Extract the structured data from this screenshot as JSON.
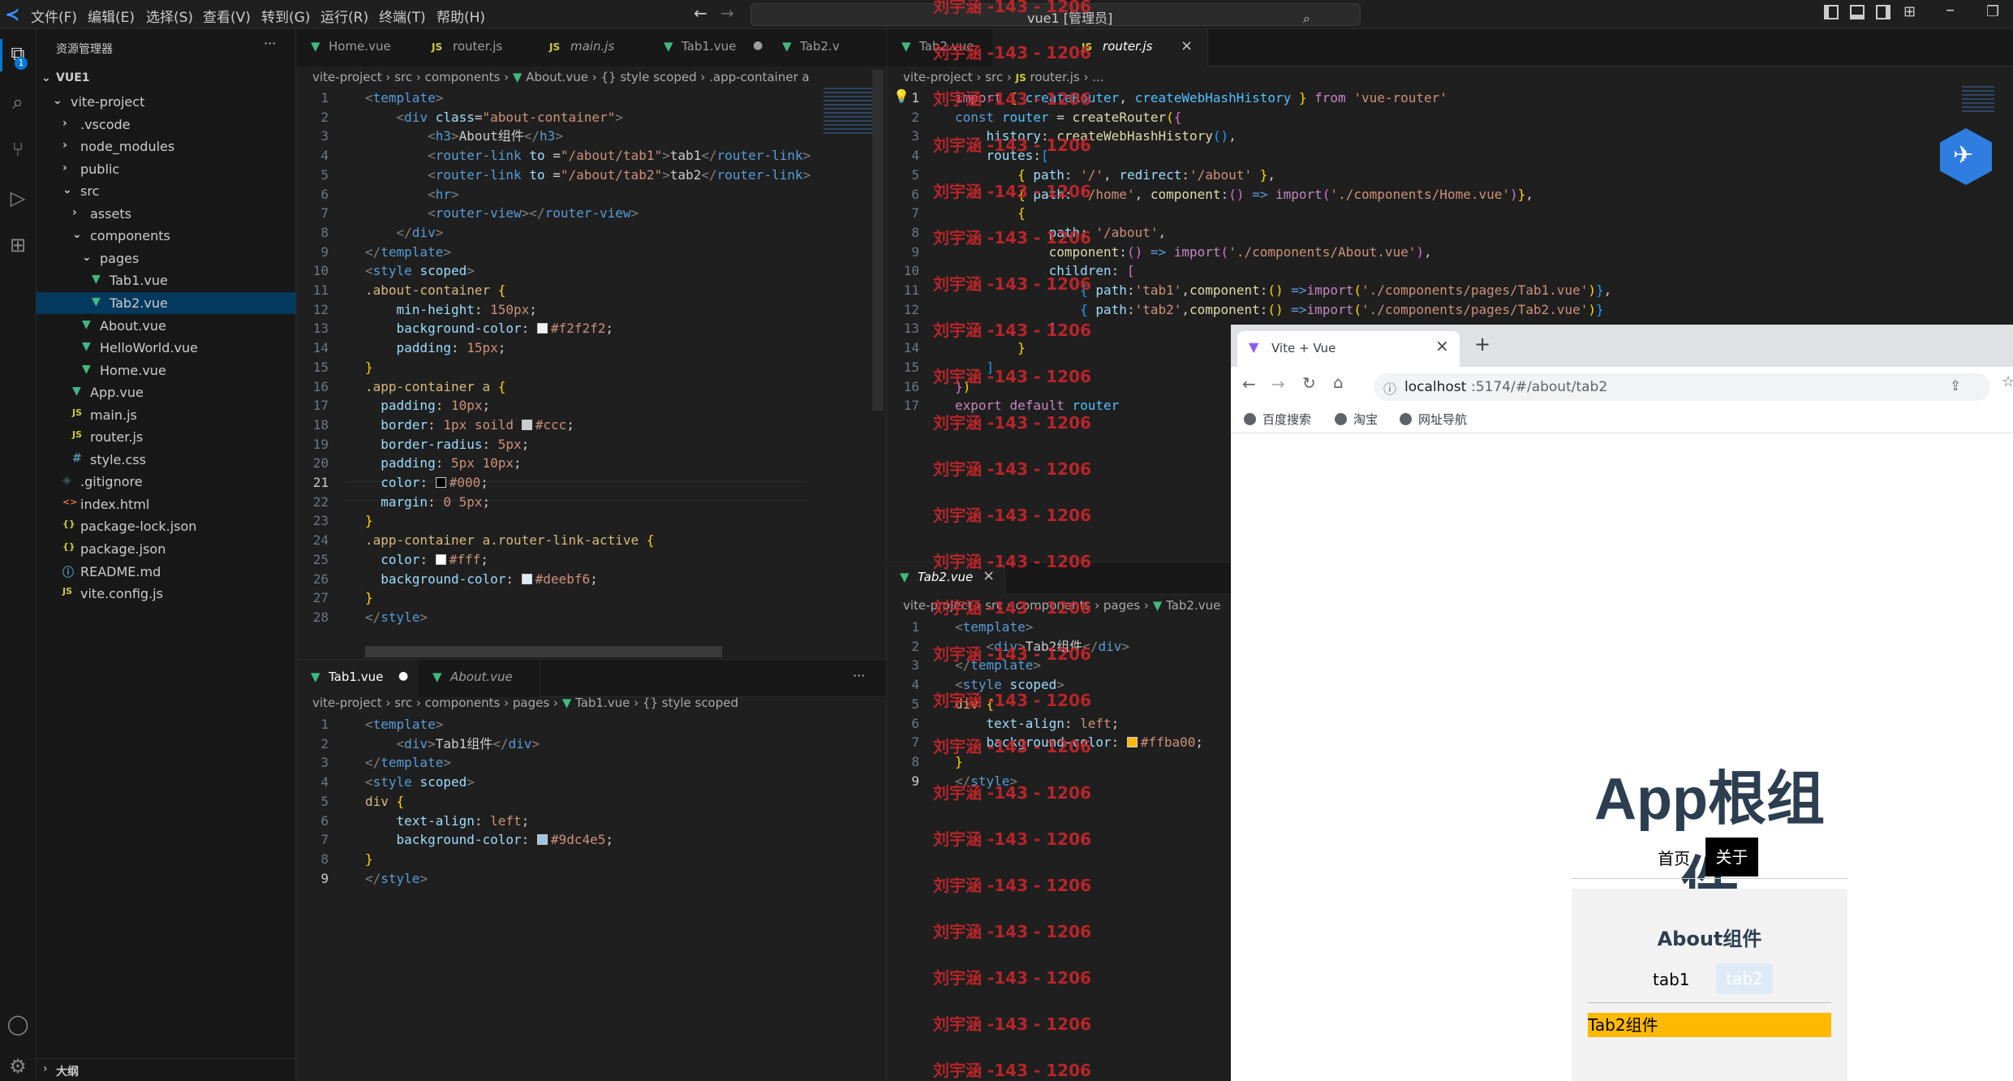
{
  "titlebar": {
    "menu": [
      "文件(F)",
      "编辑(E)",
      "选择(S)",
      "查看(V)",
      "转到(G)",
      "运行(R)",
      "终端(T)",
      "帮助(H)"
    ],
    "command_center": "vue1 [管理员]"
  },
  "sidebar": {
    "title": "资源管理器",
    "more": "···",
    "root": "VUE1",
    "items": [
      {
        "label": "vite-project",
        "icon": "chevron-down",
        "depth": 1
      },
      {
        "label": ".vscode",
        "icon": "chevron-right",
        "depth": 2
      },
      {
        "label": "node_modules",
        "icon": "chevron-right",
        "depth": 2
      },
      {
        "label": "public",
        "icon": "chevron-right",
        "depth": 2
      },
      {
        "label": "src",
        "icon": "chevron-down",
        "depth": 2
      },
      {
        "label": "assets",
        "icon": "chevron-right",
        "depth": 3
      },
      {
        "label": "components",
        "icon": "chevron-down",
        "depth": 3
      },
      {
        "label": "pages",
        "icon": "chevron-down",
        "depth": 4
      },
      {
        "label": "Tab1.vue",
        "icon": "vue",
        "depth": 5
      },
      {
        "label": "Tab2.vue",
        "icon": "vue",
        "depth": 5
      },
      {
        "label": "About.vue",
        "icon": "vue",
        "depth": 4
      },
      {
        "label": "HelloWorld.vue",
        "icon": "vue",
        "depth": 4
      },
      {
        "label": "Home.vue",
        "icon": "vue",
        "depth": 4
      },
      {
        "label": "App.vue",
        "icon": "vue",
        "depth": 3
      },
      {
        "label": "main.js",
        "icon": "js",
        "depth": 3
      },
      {
        "label": "router.js",
        "icon": "js",
        "depth": 3
      },
      {
        "label": "style.css",
        "icon": "css",
        "depth": 3
      },
      {
        "label": ".gitignore",
        "icon": "git",
        "depth": 2
      },
      {
        "label": "index.html",
        "icon": "html",
        "depth": 2
      },
      {
        "label": "package-lock.json",
        "icon": "json",
        "depth": 2
      },
      {
        "label": "package.json",
        "icon": "json",
        "depth": 2
      },
      {
        "label": "README.md",
        "icon": "info",
        "depth": 2
      },
      {
        "label": "vite.config.js",
        "icon": "js",
        "depth": 2
      }
    ],
    "outline": "大纲"
  },
  "editor_left_top": {
    "tabs": [
      "Home.vue",
      "router.js",
      "main.js",
      "Tab1.vue",
      "Tab2.v"
    ],
    "breadcrumb": [
      "vite-project",
      "src",
      "components",
      "About.vue",
      "{} style scoped",
      ".app-container a"
    ],
    "current_line": 21,
    "line_count": 28
  },
  "editor_left_bottom": {
    "tabs": [
      "Tab1.vue",
      "About.vue"
    ],
    "breadcrumb": [
      "vite-project",
      "src",
      "components",
      "pages",
      "Tab1.vue",
      "{} style scoped"
    ],
    "current_line": 9,
    "line_count": 9
  },
  "editor_right_top": {
    "tabs": [
      "Tab2.vue",
      "router.js"
    ],
    "breadcrumb": [
      "vite-project",
      "src",
      "router.js",
      "..."
    ],
    "current_line": 1,
    "line_count": 17
  },
  "editor_right_bottom": {
    "tabs": [
      "Tab2.vue"
    ],
    "breadcrumb": [
      "vite-project",
      "src",
      "components",
      "pages",
      "Tab2.vue"
    ],
    "current_line": 9,
    "line_count": 9
  },
  "watermark": "刘宇涵 -143 - 1206",
  "browser": {
    "tab_title": "Vite + Vue",
    "url_host": "localhost",
    "url_rest": ":5174/#/about/tab2",
    "bookmarks": [
      "百度搜索",
      "淘宝",
      "网址导航"
    ],
    "app_title": "App根组件",
    "nav": [
      "首页",
      "关于"
    ],
    "about_title": "About组件",
    "subnav": [
      "tab1",
      "tab2"
    ],
    "tab2_content": "Tab2组件"
  },
  "colors": {
    "editor_bg": "#1f1f1f",
    "accent": "#0078d4",
    "vue_green": "#41b883",
    "watermark": "#c8262b",
    "tab2_bg": "#ffba00",
    "active_link_bg": "#deebf6"
  }
}
